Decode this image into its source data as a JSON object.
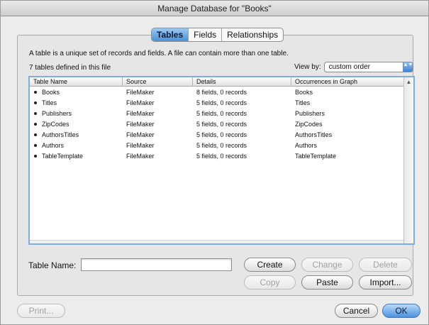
{
  "window": {
    "title": "Manage Database for \"Books\""
  },
  "tabs": [
    "Tables",
    "Fields",
    "Relationships"
  ],
  "description": "A table is a unique set of records and fields. A file can contain more than one table.",
  "table_count_text": "7 tables defined in this file",
  "view_by": {
    "label": "View by:",
    "value": "custom order",
    "arrows": "▲▼"
  },
  "table": {
    "columns": [
      "Table Name",
      "Source",
      "Details",
      "Occurrences in Graph"
    ],
    "rows": [
      {
        "name": "Books",
        "source": "FileMaker",
        "details": "8 fields, 0 records",
        "occurrences": "Books"
      },
      {
        "name": "Titles",
        "source": "FileMaker",
        "details": "5 fields, 0 records",
        "occurrences": "Titles"
      },
      {
        "name": "Publishers",
        "source": "FileMaker",
        "details": "5 fields, 0 records",
        "occurrences": "Publishers"
      },
      {
        "name": "ZipCodes",
        "source": "FileMaker",
        "details": "5 fields, 0 records",
        "occurrences": "ZipCodes"
      },
      {
        "name": "AuthorsTitles",
        "source": "FileMaker",
        "details": "5 fields, 0 records",
        "occurrences": "AuthorsTitles"
      },
      {
        "name": "Authors",
        "source": "FileMaker",
        "details": "5 fields, 0 records",
        "occurrences": "Authors"
      },
      {
        "name": "TableTemplate",
        "source": "FileMaker",
        "details": "5 fields, 0 records",
        "occurrences": "TableTemplate"
      }
    ],
    "scroll_up_icon": "▲"
  },
  "table_name_field": {
    "label": "Table Name:",
    "value": ""
  },
  "buttons": {
    "create": "Create",
    "change": "Change",
    "delete": "Delete",
    "copy": "Copy",
    "paste": "Paste",
    "import": "Import...",
    "print": "Print...",
    "cancel": "Cancel",
    "ok": "OK"
  }
}
